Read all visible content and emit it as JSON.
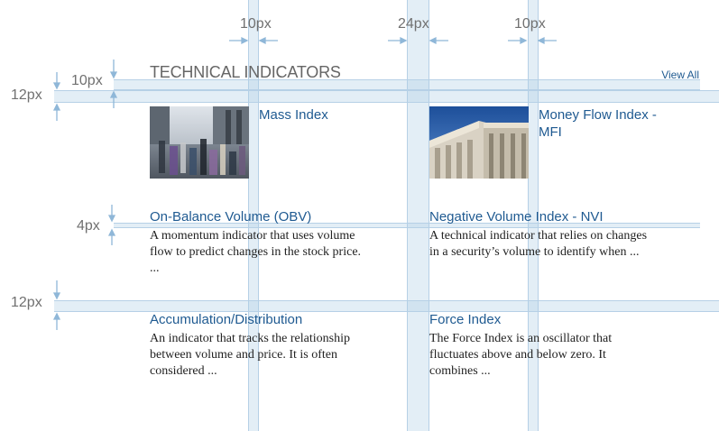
{
  "section": {
    "title": "TECHNICAL INDICATORS",
    "view_all": "View All"
  },
  "featured": [
    {
      "title": "Mass Index",
      "image": "crowd-street-photo"
    },
    {
      "title": "Money Flow Index - MFI",
      "image": "bank-building-photo"
    }
  ],
  "articles": [
    {
      "title": "On-Balance Volume (OBV)",
      "description_lines": [
        "A momentum indicator that uses volume",
        "flow to predict changes in the stock price.",
        "..."
      ]
    },
    {
      "title": "Negative Volume Index - NVI",
      "description_lines": [
        "A technical indicator that relies on changes",
        "in a security’s volume to identify when ..."
      ]
    },
    {
      "title": "Accumulation/Distribution",
      "description_lines": [
        "An indicator that tracks the relationship",
        "between volume and price. It is often",
        "considered ..."
      ]
    },
    {
      "title": "Force Index",
      "description_lines": [
        "The Force Index is an oscillator that",
        "fluctuates above and below zero. It",
        "combines ..."
      ]
    }
  ],
  "spacing_annotations": {
    "top": [
      "10px",
      "24px",
      "10px"
    ],
    "left": [
      "10px",
      "12px",
      "4px",
      "12px"
    ]
  },
  "colors": {
    "link": "#1f5a91",
    "guide": "#b6d0e6",
    "annotation_text": "#707070"
  }
}
